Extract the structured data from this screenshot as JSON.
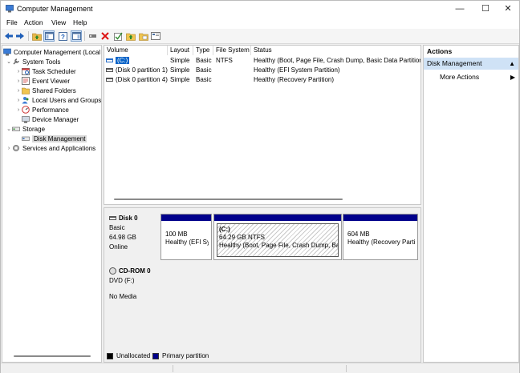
{
  "window": {
    "title": "Computer Management",
    "minimize": "—",
    "maximize": "☐",
    "close": "✕"
  },
  "menu": [
    "File",
    "Action",
    "View",
    "Help"
  ],
  "tree": {
    "root": "Computer Management (Local",
    "system_tools": "System Tools",
    "task_scheduler": "Task Scheduler",
    "event_viewer": "Event Viewer",
    "shared_folders": "Shared Folders",
    "local_users": "Local Users and Groups",
    "performance": "Performance",
    "device_manager": "Device Manager",
    "storage": "Storage",
    "disk_management": "Disk Management",
    "services": "Services and Applications"
  },
  "volume_table": {
    "headers": [
      "Volume",
      "Layout",
      "Type",
      "File System",
      "Status"
    ],
    "rows": [
      {
        "volume": "(C:)",
        "layout": "Simple",
        "type": "Basic",
        "fs": "NTFS",
        "status": "Healthy (Boot, Page File, Crash Dump, Basic Data Partition)"
      },
      {
        "volume": "(Disk 0 partition 1)",
        "layout": "Simple",
        "type": "Basic",
        "fs": "",
        "status": "Healthy (EFI System Partition)"
      },
      {
        "volume": "(Disk 0 partition 4)",
        "layout": "Simple",
        "type": "Basic",
        "fs": "",
        "status": "Healthy (Recovery Partition)"
      }
    ]
  },
  "disk0": {
    "title": "Disk 0",
    "type": "Basic",
    "size": "64.98 GB",
    "state": "Online",
    "partitions": [
      {
        "line1": "100 MB",
        "line2": "Healthy (EFI Syst"
      },
      {
        "name": "(C:)",
        "line1": "64.29 GB NTFS",
        "line2": "Healthy (Boot, Page File, Crash Dump, Basic"
      },
      {
        "line1": "604 MB",
        "line2": "Healthy (Recovery Partit"
      }
    ]
  },
  "cdrom": {
    "title": "CD-ROM 0",
    "drive": "DVD (F:)",
    "media": "No Media"
  },
  "legend": {
    "unallocated": "Unallocated",
    "primary": "Primary partition"
  },
  "actions": {
    "header": "Actions",
    "section": "Disk Management",
    "more": "More Actions"
  },
  "colors": {
    "primary_partition": "#00008b",
    "selection": "#0a64c8",
    "actions_highlight": "#cfe2f6"
  },
  "icons": [
    "back-arrow-icon",
    "forward-arrow-icon",
    "up-folder-icon",
    "show-hide-tree-icon",
    "help-icon",
    "properties-icon",
    "connect-icon",
    "delete-icon",
    "check-icon",
    "open-folder-icon",
    "folder-icon",
    "view-icon"
  ]
}
